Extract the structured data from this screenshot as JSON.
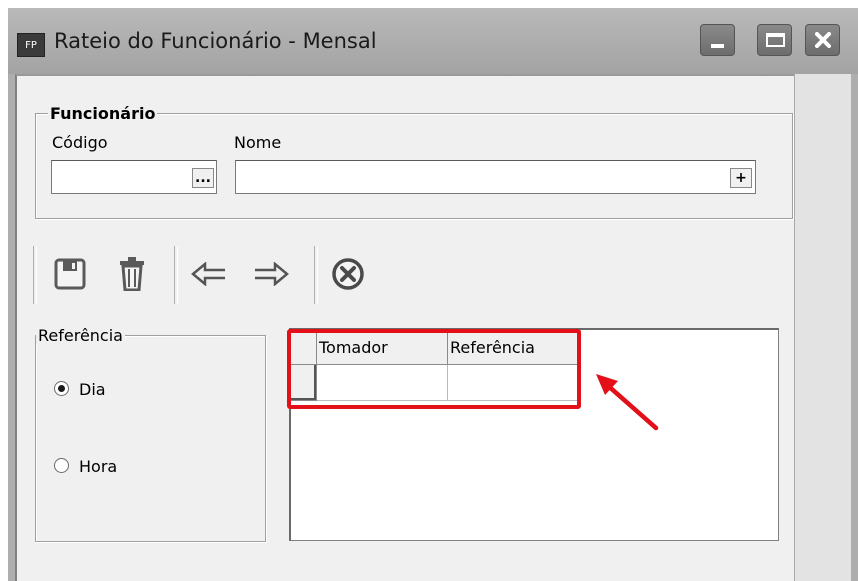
{
  "window": {
    "app_badge": "FP",
    "title": "Rateio do Funcionário - Mensal"
  },
  "funcionario": {
    "group_label": "Funcionário",
    "codigo_label": "Código",
    "codigo_value": "",
    "codigo_lookup_label": "...",
    "nome_label": "Nome",
    "nome_value": "",
    "nome_add_label": "+"
  },
  "toolbar": {
    "icons": [
      "save-icon",
      "delete-icon",
      "previous-icon",
      "next-icon",
      "cancel-icon"
    ]
  },
  "referencia": {
    "group_label": "Referência",
    "options": [
      {
        "label": "Dia",
        "selected": true
      },
      {
        "label": "Hora",
        "selected": false
      }
    ]
  },
  "grid": {
    "columns": [
      "Tomador",
      "Referência"
    ],
    "rows": [
      {
        "tomador": "",
        "referencia": ""
      }
    ]
  },
  "annotation": {
    "highlight_color": "#e3101a"
  }
}
